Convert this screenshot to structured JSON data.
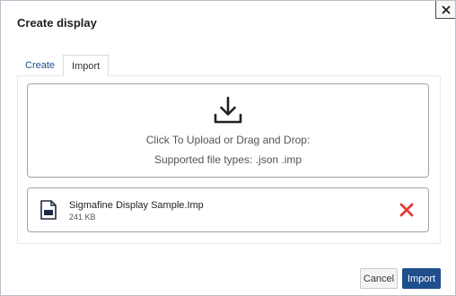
{
  "dialog": {
    "title": "Create display",
    "close_symbol": "×"
  },
  "tabs": [
    {
      "label": "Create",
      "active": false
    },
    {
      "label": "Import",
      "active": true
    }
  ],
  "dropzone": {
    "icon": "upload-icon",
    "instruction": "Click To Upload or Drag and Drop:",
    "supported": "Supported file types: .json .imp"
  },
  "file": {
    "icon": "file-icon",
    "name": "Sigmafine Display Sample.Imp",
    "size": "241 KB",
    "remove_icon": "close-x-icon"
  },
  "footer": {
    "cancel_label": "Cancel",
    "import_label": "Import"
  },
  "colors": {
    "accent": "#1f4e8c",
    "remove": "#e53935",
    "border": "#9aa3ab"
  }
}
